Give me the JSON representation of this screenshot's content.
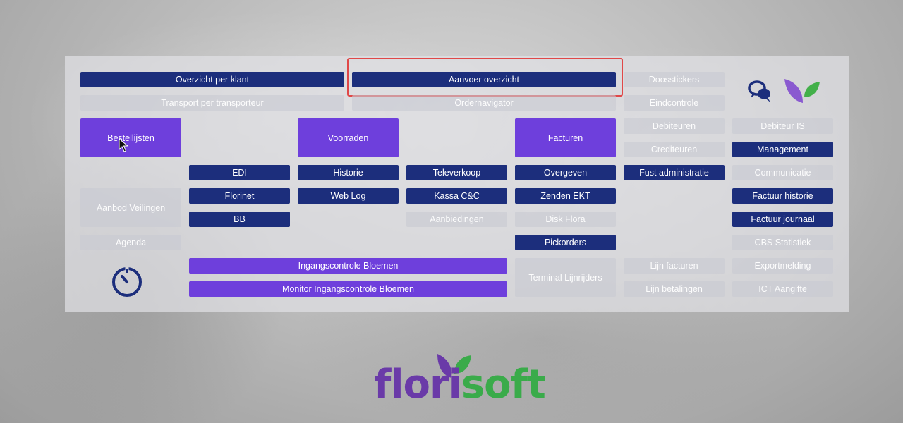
{
  "colors": {
    "primary": "#1c2e7c",
    "accent": "#6e3fdc",
    "disabled": "#c8cad2",
    "highlight": "#e04848",
    "brand_purple": "#6a3aa8",
    "brand_green": "#3aab4a"
  },
  "icons": {
    "chat": "chat-bubbles-icon",
    "leaf": "leaves-icon",
    "timer": "stopwatch-icon",
    "cursor": "mouse-cursor-icon"
  },
  "buttons": {
    "overzicht_per_klant": "Overzicht per klant",
    "aanvoer_overzicht": "Aanvoer overzicht",
    "doosstickers": "Doosstickers",
    "transport_per_transporteur": "Transport per transporteur",
    "ordernavigator": "Ordernavigator",
    "eindcontrole": "Eindcontrole",
    "bestellijsten": "Bestellijsten",
    "voorraden": "Voorraden",
    "facturen": "Facturen",
    "debiteuren": "Debiteuren",
    "debiteur_is": "Debiteur IS",
    "crediteuren": "Crediteuren",
    "management": "Management",
    "edi": "EDI",
    "historie": "Historie",
    "televerkoop": "Televerkoop",
    "overgeven": "Overgeven",
    "fust_administratie": "Fust administratie",
    "communicatie": "Communicatie",
    "aanbod_veilingen": "Aanbod Veilingen",
    "florinet": "Florinet",
    "web_log": "Web Log",
    "kassa_cc": "Kassa C&C",
    "zenden_ekt": "Zenden EKT",
    "factuur_historie": "Factuur historie",
    "bb": "BB",
    "aanbiedingen": "Aanbiedingen",
    "disk_flora": "Disk Flora",
    "factuur_journaal": "Factuur journaal",
    "agenda": "Agenda",
    "pickorders": "Pickorders",
    "cbs_statistiek": "CBS Statistiek",
    "ingangscontrole_bloemen": "Ingangscontrole Bloemen",
    "terminal_lijnrijders": "Terminal Lijnrijders",
    "lijn_facturen": "Lijn facturen",
    "exportmelding": "Exportmelding",
    "monitor_ingangscontrole_bloemen": "Monitor Ingangscontrole Bloemen",
    "lijn_betalingen": "Lijn betalingen",
    "ict_aangifte": "ICT Aangifte"
  },
  "logo": {
    "part1": "flori",
    "part2": "soft"
  }
}
